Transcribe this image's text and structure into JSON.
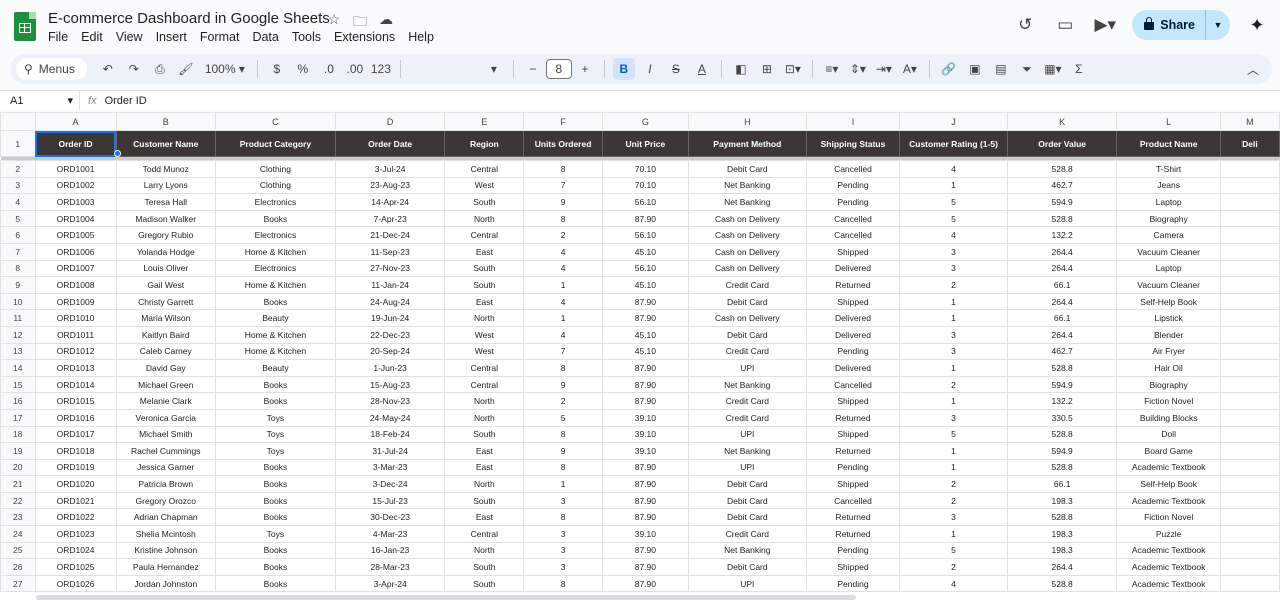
{
  "doc": {
    "title": "E-commerce Dashboard in Google Sheets"
  },
  "menu": [
    "File",
    "Edit",
    "View",
    "Insert",
    "Format",
    "Data",
    "Tools",
    "Extensions",
    "Help"
  ],
  "share_label": "Share",
  "toolbar": {
    "search_label": "Menus",
    "zoom": "100%",
    "currency": "$",
    "percent": "%",
    "dec_dec": ".0",
    "dec_inc": ".00",
    "number_format": "123",
    "font_size": "8"
  },
  "formula": {
    "cell_ref": "A1",
    "content": "Order ID"
  },
  "columns": [
    "A",
    "B",
    "C",
    "D",
    "E",
    "F",
    "G",
    "H",
    "I",
    "J",
    "K",
    "L",
    "M"
  ],
  "headers": [
    "Order ID",
    "Customer Name",
    "Product Category",
    "Order Date",
    "Region",
    "Units Ordered",
    "Unit Price",
    "Payment Method",
    "Shipping Status",
    "Customer Rating (1-5)",
    "Order Value",
    "Product Name",
    "Deli"
  ],
  "rows": [
    [
      "ORD1001",
      "Todd Munoz",
      "Clothing",
      "3-Jul-24",
      "Central",
      "8",
      "70.10",
      "Debit Card",
      "Cancelled",
      "4",
      "528.8",
      "T-Shirt"
    ],
    [
      "ORD1002",
      "Larry Lyons",
      "Clothing",
      "23-Aug-23",
      "West",
      "7",
      "70.10",
      "Net Banking",
      "Pending",
      "1",
      "462.7",
      "Jeans"
    ],
    [
      "ORD1003",
      "Teresa Hall",
      "Electronics",
      "14-Apr-24",
      "South",
      "9",
      "56.10",
      "Net Banking",
      "Pending",
      "5",
      "594.9",
      "Laptop"
    ],
    [
      "ORD1004",
      "Madison Walker",
      "Books",
      "7-Apr-23",
      "North",
      "8",
      "87.90",
      "Cash on Delivery",
      "Cancelled",
      "5",
      "528.8",
      "Biography"
    ],
    [
      "ORD1005",
      "Gregory Rubio",
      "Electronics",
      "21-Dec-24",
      "Central",
      "2",
      "56.10",
      "Cash on Delivery",
      "Cancelled",
      "4",
      "132.2",
      "Camera"
    ],
    [
      "ORD1006",
      "Yolanda Hodge",
      "Home & Kitchen",
      "11-Sep-23",
      "East",
      "4",
      "45.10",
      "Cash on Delivery",
      "Shipped",
      "3",
      "264.4",
      "Vacuum Cleaner"
    ],
    [
      "ORD1007",
      "Louis Oliver",
      "Electronics",
      "27-Nov-23",
      "South",
      "4",
      "56.10",
      "Cash on Delivery",
      "Delivered",
      "3",
      "264.4",
      "Laptop"
    ],
    [
      "ORD1008",
      "Gail West",
      "Home & Kitchen",
      "11-Jan-24",
      "South",
      "1",
      "45.10",
      "Credit Card",
      "Returned",
      "2",
      "66.1",
      "Vacuum Cleaner"
    ],
    [
      "ORD1009",
      "Christy Garrett",
      "Books",
      "24-Aug-24",
      "East",
      "4",
      "87.90",
      "Debit Card",
      "Shipped",
      "1",
      "264.4",
      "Self-Help Book"
    ],
    [
      "ORD1010",
      "Maria Wilson",
      "Beauty",
      "19-Jun-24",
      "North",
      "1",
      "87.90",
      "Cash on Delivery",
      "Delivered",
      "1",
      "66.1",
      "Lipstick"
    ],
    [
      "ORD1011",
      "Kaitlyn Baird",
      "Home & Kitchen",
      "22-Dec-23",
      "West",
      "4",
      "45.10",
      "Debit Card",
      "Delivered",
      "3",
      "264.4",
      "Blender"
    ],
    [
      "ORD1012",
      "Caleb Carney",
      "Home & Kitchen",
      "20-Sep-24",
      "West",
      "7",
      "45.10",
      "Credit Card",
      "Pending",
      "3",
      "462.7",
      "Air Fryer"
    ],
    [
      "ORD1013",
      "David Gay",
      "Beauty",
      "1-Jun-23",
      "Central",
      "8",
      "87.90",
      "UPI",
      "Delivered",
      "1",
      "528.8",
      "Hair Oil"
    ],
    [
      "ORD1014",
      "Michael Green",
      "Books",
      "15-Aug-23",
      "Central",
      "9",
      "87.90",
      "Net Banking",
      "Cancelled",
      "2",
      "594.9",
      "Biography"
    ],
    [
      "ORD1015",
      "Melanie Clark",
      "Books",
      "28-Nov-23",
      "North",
      "2",
      "87.90",
      "Credit Card",
      "Shipped",
      "1",
      "132.2",
      "Fiction Novel"
    ],
    [
      "ORD1016",
      "Veronica Garcia",
      "Toys",
      "24-May-24",
      "North",
      "5",
      "39.10",
      "Credit Card",
      "Returned",
      "3",
      "330.5",
      "Building Blocks"
    ],
    [
      "ORD1017",
      "Michael Smith",
      "Toys",
      "18-Feb-24",
      "South",
      "8",
      "39.10",
      "UPI",
      "Shipped",
      "5",
      "528.8",
      "Doll"
    ],
    [
      "ORD1018",
      "Rachel Cummings",
      "Toys",
      "31-Jul-24",
      "East",
      "9",
      "39.10",
      "Net Banking",
      "Returned",
      "1",
      "594.9",
      "Board Game"
    ],
    [
      "ORD1019",
      "Jessica Garner",
      "Books",
      "3-Mar-23",
      "East",
      "8",
      "87.90",
      "UPI",
      "Pending",
      "1",
      "528.8",
      "Academic Textbook"
    ],
    [
      "ORD1020",
      "Patricia Brown",
      "Books",
      "3-Dec-24",
      "North",
      "1",
      "87.90",
      "Debit Card",
      "Shipped",
      "2",
      "66.1",
      "Self-Help Book"
    ],
    [
      "ORD1021",
      "Gregory Orozco",
      "Books",
      "15-Jul-23",
      "South",
      "3",
      "87.90",
      "Debit Card",
      "Cancelled",
      "2",
      "198.3",
      "Academic Textbook"
    ],
    [
      "ORD1022",
      "Adrian Chapman",
      "Books",
      "30-Dec-23",
      "East",
      "8",
      "87.90",
      "Debit Card",
      "Returned",
      "3",
      "528.8",
      "Fiction Novel"
    ],
    [
      "ORD1023",
      "Shelia Mcintosh",
      "Toys",
      "4-Mar-23",
      "Central",
      "3",
      "39.10",
      "Credit Card",
      "Returned",
      "1",
      "198.3",
      "Puzzle"
    ],
    [
      "ORD1024",
      "Kristine Johnson",
      "Books",
      "16-Jan-23",
      "North",
      "3",
      "87.90",
      "Net Banking",
      "Pending",
      "5",
      "198.3",
      "Academic Textbook"
    ],
    [
      "ORD1025",
      "Paula Hernandez",
      "Books",
      "28-Mar-23",
      "South",
      "3",
      "87.90",
      "Debit Card",
      "Shipped",
      "2",
      "264.4",
      "Academic Textbook"
    ],
    [
      "ORD1026",
      "Jordan Johnston",
      "Books",
      "3-Apr-24",
      "South",
      "8",
      "87.90",
      "UPI",
      "Pending",
      "4",
      "528.8",
      "Academic Textbook"
    ]
  ]
}
